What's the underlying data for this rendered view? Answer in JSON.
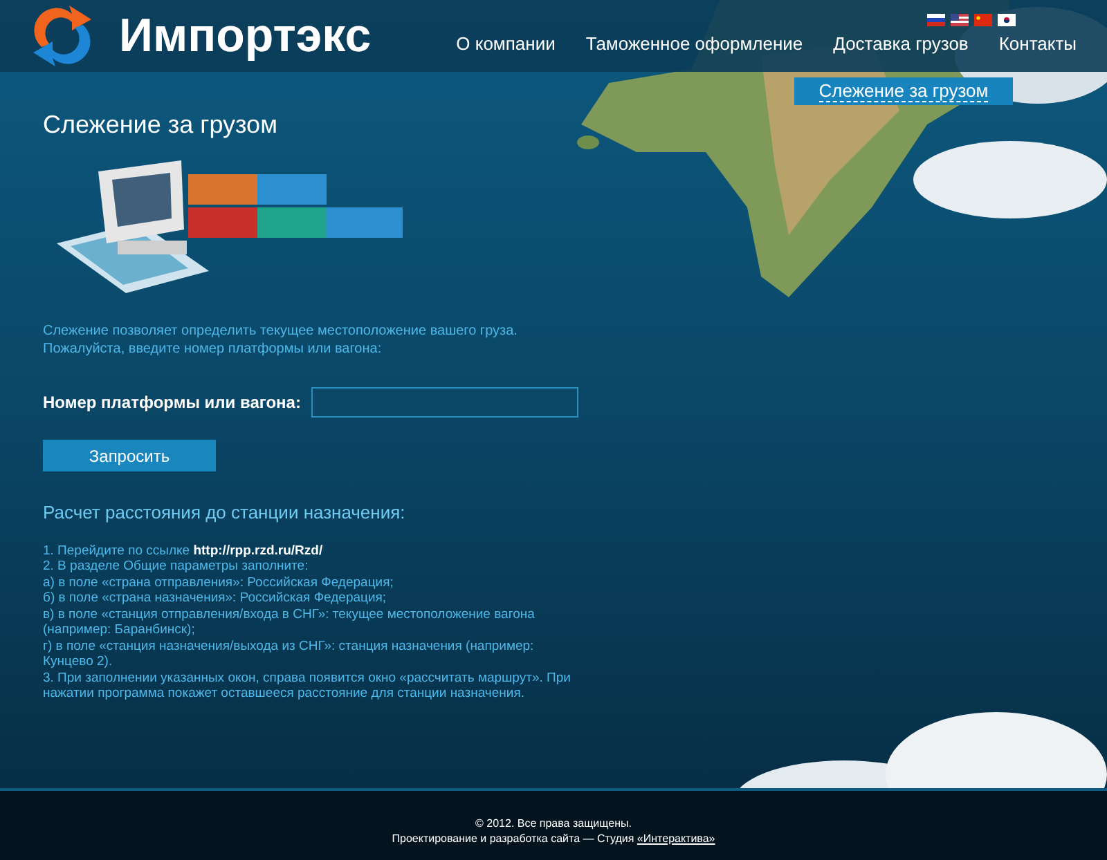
{
  "header": {
    "logo_text": "Импортэкс",
    "nav": [
      {
        "label": "О компании",
        "selected": false
      },
      {
        "label": "Таможенное оформление",
        "selected": false
      },
      {
        "label": "Доставка грузов",
        "selected": false
      },
      {
        "label": "Контакты",
        "selected": false
      }
    ]
  },
  "subnav": [
    {
      "label": "Слежение за грузом",
      "selected": true
    }
  ],
  "page_title": "Слежение за грузом",
  "intro": "Слежение позволяет определить текущее местоположение вашего груза. Пожалуйста, введите номер платформы или вагона:",
  "form": {
    "label": "Номер платформы или вагона:",
    "submit": "Запросить"
  },
  "distance": {
    "title": "Расчет расстояния до станции назначения:",
    "steps": [
      {
        "text": "1. Перейдите по ссылке ",
        "link": "http://rpp.rzd.ru/Rzd/"
      },
      {
        "text": "2. В разделе Общие параметры заполните:"
      },
      {
        "text": "а) в поле «страна отправления»: Российская Федерация;"
      },
      {
        "text": "б) в поле «страна назначения»: Российская Федерация;"
      },
      {
        "text": "в) в поле «станция отправления/входа в СНГ»: текущее местоположение вагона (например: Баранбинск);"
      },
      {
        "text": "г) в поле «станция назначения/выхода из СНГ»: станция назначения (например: Кунцево 2)."
      },
      {
        "text": "3. При заполнении указанных окон, справа появится окно «рассчитать маршрут». При нажатии программа покажет оставшееся расстояние для станции назначения."
      }
    ]
  },
  "footer": {
    "copyright": "© 2012. Все права защищены.",
    "credit": "Проектирование и разработка сайта — Студия ",
    "credit_link": "«Интерактива»"
  }
}
